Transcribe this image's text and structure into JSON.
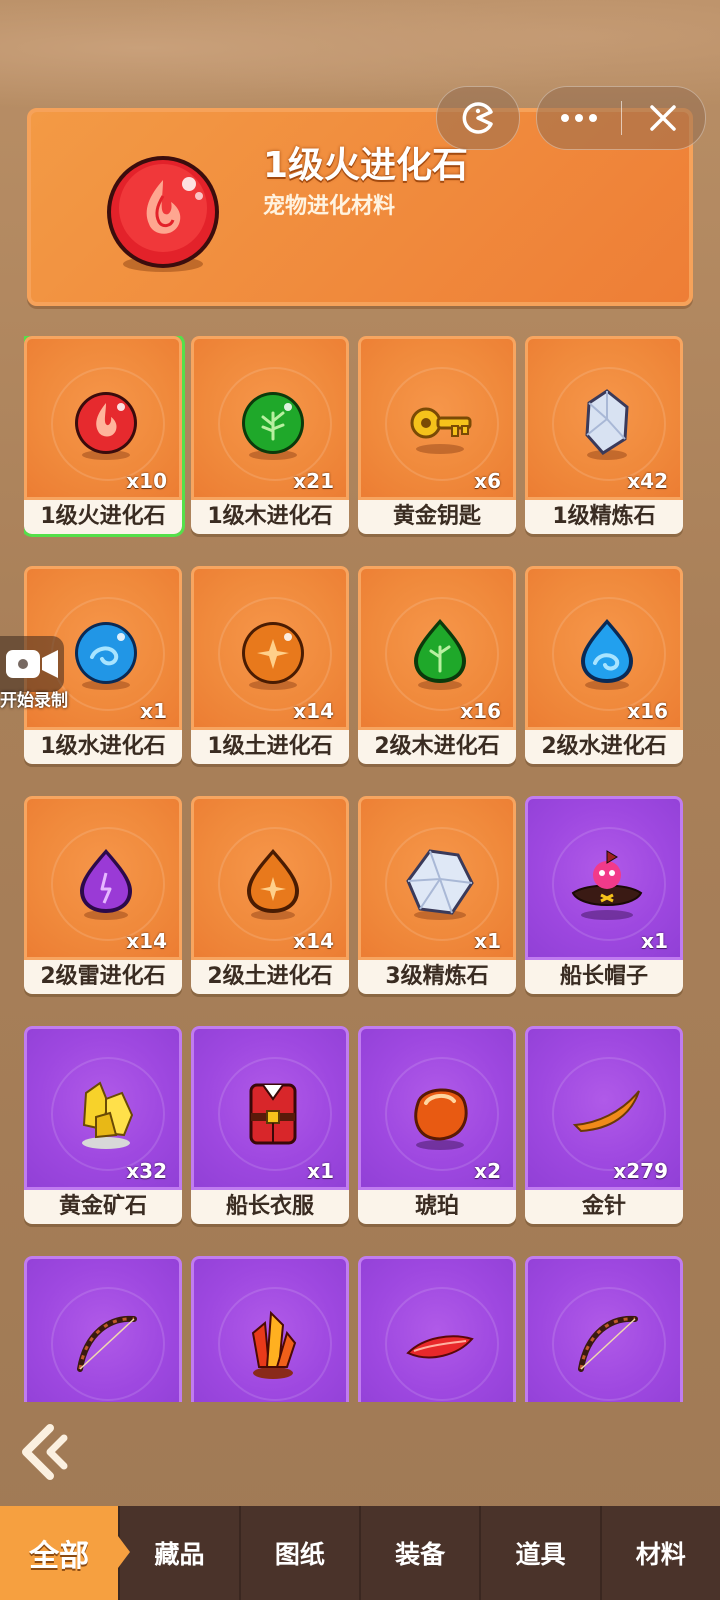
{
  "detail": {
    "title": "1级火进化石",
    "subtitle": "宠物进化材料"
  },
  "items": [
    {
      "label": "1级火进化石",
      "count": "x10",
      "icon": "fire-orb-icon",
      "rarity": "orange",
      "selected": true
    },
    {
      "label": "1级木进化石",
      "count": "x21",
      "icon": "wood-orb-icon",
      "rarity": "orange"
    },
    {
      "label": "黄金钥匙",
      "count": "x6",
      "icon": "gold-key-icon",
      "rarity": "orange"
    },
    {
      "label": "1级精炼石",
      "count": "x42",
      "icon": "refine-stone-icon",
      "rarity": "orange"
    },
    {
      "label": "1级水进化石",
      "count": "x1",
      "icon": "water-orb-icon",
      "rarity": "orange"
    },
    {
      "label": "1级土进化石",
      "count": "x14",
      "icon": "earth-orb-icon",
      "rarity": "orange"
    },
    {
      "label": "2级木进化石",
      "count": "x16",
      "icon": "wood-drop-icon",
      "rarity": "orange"
    },
    {
      "label": "2级水进化石",
      "count": "x16",
      "icon": "water-drop-icon",
      "rarity": "orange"
    },
    {
      "label": "2级雷进化石",
      "count": "x14",
      "icon": "thunder-drop-icon",
      "rarity": "orange"
    },
    {
      "label": "2级土进化石",
      "count": "x14",
      "icon": "earth-drop-icon",
      "rarity": "orange"
    },
    {
      "label": "3级精炼石",
      "count": "x1",
      "icon": "big-refine-stone-icon",
      "rarity": "orange"
    },
    {
      "label": "船长帽子",
      "count": "x1",
      "icon": "captain-hat-icon",
      "rarity": "purple"
    },
    {
      "label": "黄金矿石",
      "count": "x32",
      "icon": "gold-ore-icon",
      "rarity": "purple"
    },
    {
      "label": "船长衣服",
      "count": "x1",
      "icon": "captain-coat-icon",
      "rarity": "purple"
    },
    {
      "label": "琥珀",
      "count": "x2",
      "icon": "amber-icon",
      "rarity": "purple"
    },
    {
      "label": "金针",
      "count": "x279",
      "icon": "gold-needle-icon",
      "rarity": "purple"
    },
    {
      "label": "",
      "count": "",
      "icon": "bow-icon",
      "rarity": "purple"
    },
    {
      "label": "",
      "count": "",
      "icon": "red-crystal-icon",
      "rarity": "purple"
    },
    {
      "label": "",
      "count": "",
      "icon": "red-feather-icon",
      "rarity": "purple"
    },
    {
      "label": "",
      "count": "",
      "icon": "bow-icon",
      "rarity": "purple"
    }
  ],
  "recorder": {
    "label": "开始录制"
  },
  "tabs": [
    "全部",
    "藏品",
    "图纸",
    "装备",
    "道具",
    "材料"
  ],
  "active_tab": "全部",
  "colors": {
    "orange_card": "#f08a3c",
    "purple_card": "#9e48e0",
    "tab_active": "#f6a040",
    "tabbar": "#4a332a",
    "selected_border": "#55e04a"
  }
}
